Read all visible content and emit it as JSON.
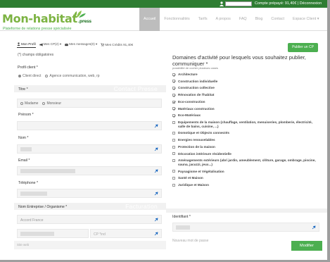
{
  "topbar": {
    "credit_text": "Compte prépayé: 91,40€ | Déconnexion"
  },
  "brand": {
    "logo": "Mon-habitat",
    "logo_suffix": ".press",
    "tagline": "Plateforme de relations presse spécialisée",
    "accent": "#7cb342",
    "dark": "#2e7d32"
  },
  "nav": {
    "items": [
      "Accueil",
      "Fonctionnalités",
      "Tarifs",
      "A propos",
      "FAQ",
      "Blog",
      "Contact",
      "Espace Client ▾"
    ],
    "active_index": 0
  },
  "profile_tabs": [
    {
      "label": "Mon Profil",
      "icon": "user-icon"
    },
    {
      "label": "Mes CP(2) ▾",
      "icon": "megaphone-icon"
    },
    {
      "label": "Mes messages(0) ▾",
      "icon": "envelope-icon"
    },
    {
      "label": "Mes Crédits 91,40€",
      "icon": "cart-icon"
    }
  ],
  "form": {
    "required_note": "(*) champs obligatoires",
    "profile_label": "Profil client *",
    "profile_options": [
      "Client direct",
      "Agence communication, web, rp"
    ],
    "section_contact": "Contact Presse",
    "title_label": "Titre *",
    "title_options": [
      "Madame",
      "Monsieur"
    ],
    "firstname_label": "Prénom *",
    "lastname_label": "Nom *",
    "email_label": "Email *",
    "phone_label": "Téléphone *",
    "section_billing": "Facturation",
    "company_label": "Nom Entreprise / Organisme *",
    "country_value": "Accord France",
    "cp_placeholder": "CP *ind",
    "bottom_placeholder": "Site web"
  },
  "domains": {
    "publish_button": "Publier un CP",
    "title": "Domaines d'activité pour lesquels vous souhaitez publier, communiquer *",
    "subtitle": "possibilité de cocher plusieurs cases",
    "items": [
      {
        "label": "Architecture",
        "checked": true
      },
      {
        "label": "Construction individuelle",
        "checked": true
      },
      {
        "label": "Construction collective",
        "checked": true
      },
      {
        "label": "Rénovation de l'habitat",
        "checked": true
      },
      {
        "label": "Eco-construction",
        "checked": true
      },
      {
        "label": "Matériaux construction",
        "checked": true
      },
      {
        "label": "Eco-Matériaux",
        "checked": true
      },
      {
        "label": "Equipements de la maison (chauffage, ventilation, menuiseries, plomberie, électricité, salle de bains, cuisine, ...)",
        "checked": false
      },
      {
        "label": "Domotique et Objects connectés",
        "checked": false
      },
      {
        "label": "Energies renouvelables",
        "checked": false
      },
      {
        "label": "Protection de la maison",
        "checked": false
      },
      {
        "label": "Décoration intérieure résidentielle",
        "checked": false
      },
      {
        "label": "Aménagements extérieurs (abri jardin, ameublement, clôture, garage, ombrage, piscine, sauna, jacuzzi, jeux...)",
        "checked": false
      },
      {
        "label": "Paysagisme et Végétalisation",
        "checked": false
      },
      {
        "label": "Santé et Maison",
        "checked": false
      },
      {
        "label": "Juridique et Maison",
        "checked": false
      }
    ]
  },
  "account": {
    "id_label": "Identifiant *",
    "password_label": "Nouveau mot de passe",
    "modify_button": "Modifier"
  }
}
